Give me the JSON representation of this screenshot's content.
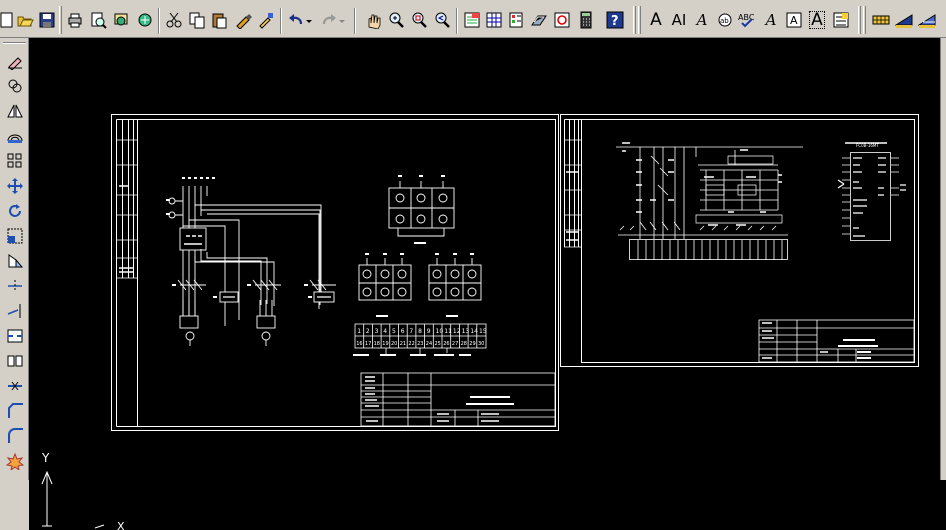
{
  "toolbar": {
    "buttons": [
      "new-icon",
      "open-icon",
      "save-icon",
      "print-icon",
      "print-preview-icon",
      "publish-icon",
      "plot-icon",
      "cut-icon",
      "copy-icon",
      "paste-icon",
      "match-properties-icon",
      "block-editor-icon",
      "undo-icon",
      "redo-icon",
      "pan-icon",
      "zoom-realtime-icon",
      "zoom-window-icon",
      "zoom-previous-icon",
      "properties-icon",
      "design-center-icon",
      "tool-palettes-icon",
      "sheet-set-icon",
      "markup-icon",
      "calculator-icon",
      "help-icon",
      "text-icon",
      "multiline-text-icon",
      "edit-text-icon",
      "find-replace-icon",
      "spelling-icon",
      "text-style-icon",
      "scale-text-icon",
      "justify-text-icon",
      "convert-space-icon",
      "table-icon",
      "table-style-icon",
      "insert-table-icon"
    ],
    "text_glyphs": {
      "text": "A",
      "mtext": "AI",
      "edit": "A",
      "spell": "ABC",
      "scale": "A"
    }
  },
  "leftbar": {
    "buttons": [
      "erase-icon",
      "copy-object-icon",
      "mirror-icon",
      "offset-icon",
      "array-icon",
      "move-icon",
      "rotate-icon",
      "scale-icon",
      "stretch-icon",
      "trim-icon",
      "extend-icon",
      "break-icon",
      "join-icon",
      "chamfer-icon",
      "fillet-icon",
      "explode-icon"
    ]
  },
  "drawing": {
    "ucs_y": "Y",
    "ucs_x": "X",
    "sheet1": {
      "panel_labels": [
        "漏电",
        "漏",
        "定"
      ],
      "phase_labels": [
        "L1",
        "L2",
        "L3",
        "N",
        "PE"
      ],
      "terminal_numbers": [
        "1",
        "2",
        "3",
        "4",
        "5",
        "6",
        "7",
        "8",
        "9",
        "10",
        "11",
        "12",
        "13",
        "14",
        "15"
      ],
      "terminal_numbers_lower": [
        "16",
        "17",
        "18",
        "19",
        "20",
        "21",
        "22",
        "23",
        "24",
        "25",
        "26",
        "27",
        "28",
        "29",
        "30"
      ]
    },
    "sheet2": {
      "plc_title": "FC0B-16MT"
    }
  }
}
